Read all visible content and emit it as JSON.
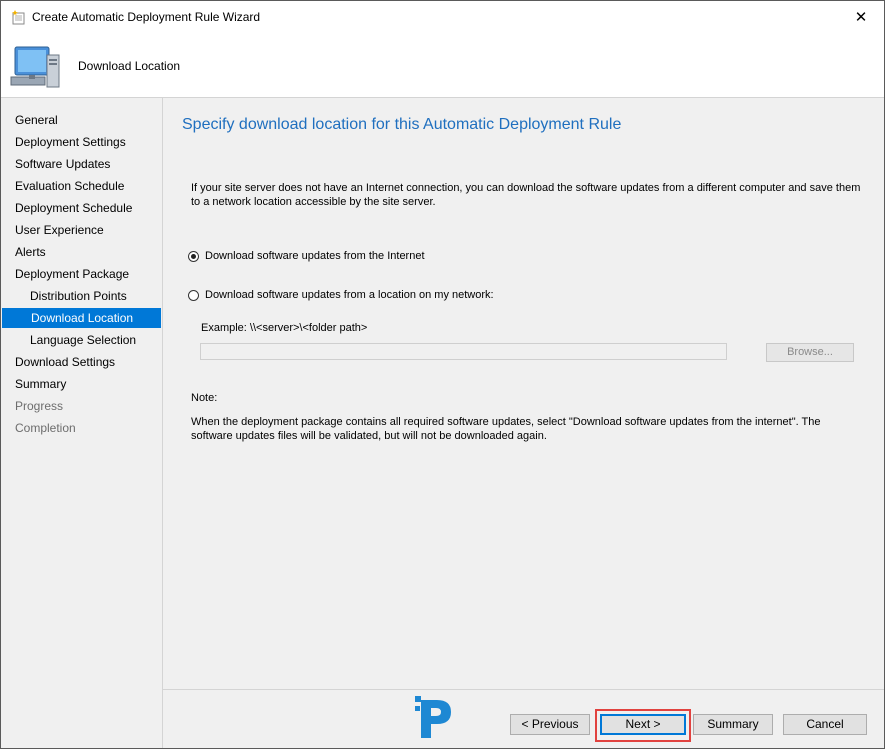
{
  "window": {
    "title": "Create Automatic Deployment Rule Wizard",
    "close_glyph": "✕"
  },
  "header": {
    "title": "Download Location"
  },
  "sidebar": {
    "items": [
      {
        "label": "General",
        "state": "normal",
        "level": 0
      },
      {
        "label": "Deployment Settings",
        "state": "normal",
        "level": 0
      },
      {
        "label": "Software Updates",
        "state": "normal",
        "level": 0
      },
      {
        "label": "Evaluation Schedule",
        "state": "normal",
        "level": 0
      },
      {
        "label": "Deployment Schedule",
        "state": "normal",
        "level": 0
      },
      {
        "label": "User Experience",
        "state": "normal",
        "level": 0
      },
      {
        "label": "Alerts",
        "state": "normal",
        "level": 0
      },
      {
        "label": "Deployment Package",
        "state": "normal",
        "level": 0
      },
      {
        "label": "Distribution Points",
        "state": "normal",
        "level": 1
      },
      {
        "label": "Download Location",
        "state": "selected",
        "level": 1
      },
      {
        "label": "Language Selection",
        "state": "normal",
        "level": 1
      },
      {
        "label": "Download Settings",
        "state": "normal",
        "level": 0
      },
      {
        "label": "Summary",
        "state": "normal",
        "level": 0
      },
      {
        "label": "Progress",
        "state": "disabled",
        "level": 0
      },
      {
        "label": "Completion",
        "state": "disabled",
        "level": 0
      }
    ]
  },
  "main": {
    "heading": "Specify download location for this Automatic Deployment Rule",
    "description": "If your site server does not have an Internet connection, you can download the software updates from a different computer and save them to a network location accessible by the site server.",
    "option_internet": "Download software updates from the Internet",
    "option_network": "Download software updates from a location on my network:",
    "selected_option": "internet",
    "example": "Example: \\\\<server>\\<folder path>",
    "path_value": "",
    "browse_label": "Browse...",
    "note_label": "Note:",
    "note_text": "When the deployment package contains all required software updates, select \"Download  software updates from the internet\". The software updates files will be validated, but will not be downloaded again."
  },
  "footer": {
    "previous_label": "< Previous",
    "next_label": "Next >",
    "summary_label": "Summary",
    "cancel_label": "Cancel"
  },
  "colors": {
    "accent": "#0078d7",
    "heading": "#1f6fbf",
    "highlight": "#e1423f",
    "logo": "#1e88d3"
  }
}
